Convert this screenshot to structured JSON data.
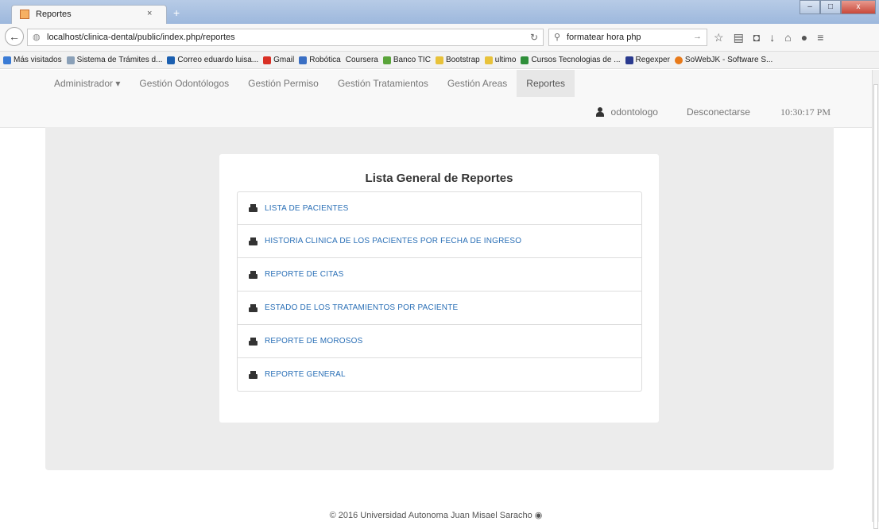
{
  "browser": {
    "tab_title": "Reportes",
    "tab_close": "×",
    "new_tab": "+",
    "url": "localhost/clinica-dental/public/index.php/reportes",
    "search_text": "formatear hora php",
    "window_buttons": {
      "minimize": "–",
      "maximize": "□",
      "close": "x"
    }
  },
  "bookmarks": [
    {
      "label": "Más visitados",
      "color": "#3a7bd5"
    },
    {
      "label": "Sistema de Trámites d...",
      "color": "#8aa0b8"
    },
    {
      "label": "Correo eduardo luisa...",
      "color": "#1b5fb0"
    },
    {
      "label": "Gmail",
      "color": "#d93025"
    },
    {
      "label": "Robótica",
      "color": "#3a6fc4"
    },
    {
      "label": "Coursera",
      "color": "#ffffff"
    },
    {
      "label": "Banco TIC",
      "color": "#5aa43a"
    },
    {
      "label": "Bootstrap",
      "color": "#e8c23a"
    },
    {
      "label": "ultimo",
      "color": "#e8c23a"
    },
    {
      "label": "Cursos Tecnologias de ...",
      "color": "#2f8f3a"
    },
    {
      "label": "Regexper",
      "color": "#2a3a8f"
    },
    {
      "label": "SoWebJK - Software S...",
      "color": "#e87a1a"
    }
  ],
  "menu": {
    "items": [
      "Administrador ▾",
      "Gestión Odontólogos",
      "Gestión Permiso",
      "Gestión Tratamientos",
      "Gestión Areas",
      "Reportes"
    ],
    "active_index": 5
  },
  "user": {
    "name": "odontologo",
    "logout": "Desconectarse",
    "time": "10:30:17 PM"
  },
  "reports": {
    "title": "Lista General de Reportes",
    "items": [
      "LISTA DE PACIENTES",
      "HISTORIA CLINICA DE LOS PACIENTES POR FECHA DE INGRESO",
      "REPORTE DE CITAS",
      "ESTADO DE LOS TRATAMIENTOS POR PACIENTE",
      "REPORTE DE MOROSOS",
      "REPORTE GENERAL"
    ]
  },
  "footer": {
    "text": "© 2016 Universidad Autonoma Juan Misael Saracho"
  }
}
